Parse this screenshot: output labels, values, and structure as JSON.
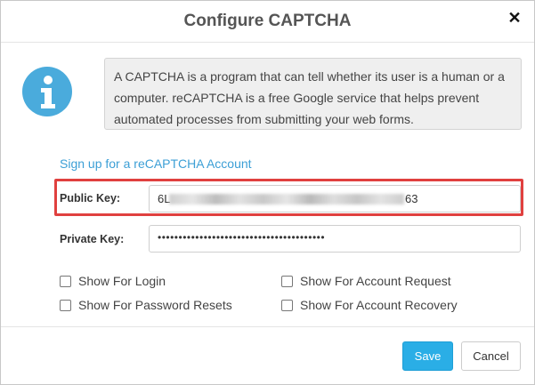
{
  "dialog": {
    "title": "Configure CAPTCHA",
    "close_glyph": "✕"
  },
  "info": {
    "icon": "info-icon",
    "text": "A CAPTCHA is a program that can tell whether its user is a human or a computer. reCAPTCHA is a free Google service that helps prevent automated processes from submitting your web forms."
  },
  "signup_link": "Sign up for a reCAPTCHA Account",
  "public_key": {
    "label": "Public Key:",
    "value_start": "6L",
    "value_end": "63",
    "obscured": true
  },
  "private_key": {
    "label": "Private Key:",
    "value": "••••••••••••••••••••••••••••••••••••••••"
  },
  "options": [
    {
      "label": "Show For Login",
      "checked": false
    },
    {
      "label": "Show For Account Request",
      "checked": false
    },
    {
      "label": "Show For Password Resets",
      "checked": false
    },
    {
      "label": "Show For Account Recovery",
      "checked": false
    }
  ],
  "buttons": {
    "save": "Save",
    "cancel": "Cancel"
  },
  "colors": {
    "accent": "#2aaee6",
    "link": "#3c9fd6",
    "highlight": "#e0403f",
    "info_icon": "#4aabdc"
  }
}
